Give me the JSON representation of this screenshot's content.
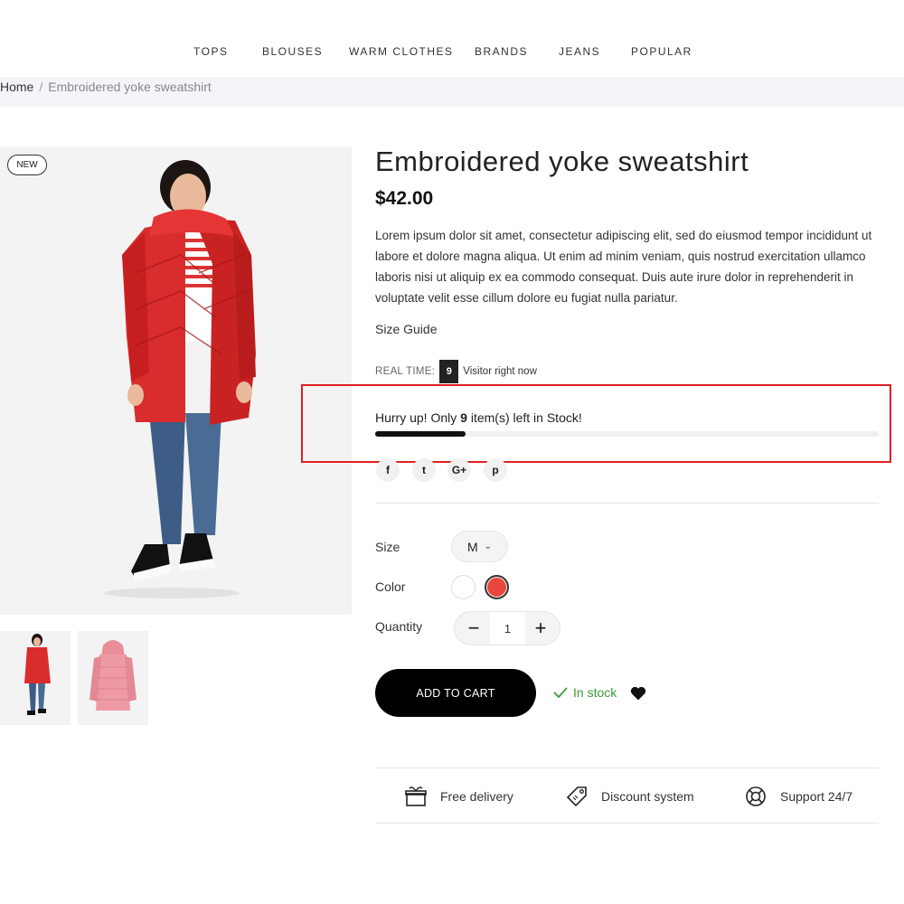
{
  "nav": {
    "items": [
      "TOPS",
      "BLOUSES",
      "WARM CLOTHES",
      "BRANDS",
      "JEANS",
      "POPULAR"
    ]
  },
  "breadcrumb": {
    "home": "Home",
    "separator": "/",
    "current": "Embroidered yoke sweatshirt"
  },
  "gallery": {
    "badge": "NEW",
    "thumbnails": [
      "red-coat-model",
      "pink-coat"
    ]
  },
  "product": {
    "title": "Embroidered yoke sweatshirt",
    "price": "$42.00",
    "description": "Lorem ipsum dolor sit amet, consectetur adipiscing elit, sed do eiusmod tempor incididunt ut labore et dolore magna aliqua. Ut enim ad minim veniam, quis nostrud exercitation ullamco laboris nisi ut aliquip ex ea commodo consequat. Duis aute irure dolor in reprehenderit in voluptate velit esse cillum dolore eu fugiat nulla pariatur.",
    "size_guide": "Size Guide"
  },
  "realtime": {
    "label": "REAL TIME:",
    "count": "9",
    "suffix": "Visitor right now"
  },
  "stock": {
    "prefix": "Hurry up! Only",
    "count": "9",
    "suffix": "item(s) left in Stock!",
    "progress_fraction": 0.18
  },
  "social": {
    "icons": [
      "facebook-icon",
      "twitter-icon",
      "google-plus-icon",
      "pinterest-icon"
    ],
    "glyphs": [
      "f",
      "t",
      "G+",
      "p"
    ]
  },
  "options": {
    "size_label": "Size",
    "size_value": "M",
    "color_label": "Color",
    "colors": [
      "#ffffff",
      "#e8473b"
    ],
    "quantity_label": "Quantity",
    "quantity_value": "1",
    "minus": "−",
    "plus": "+"
  },
  "actions": {
    "add_to_cart": "ADD TO CART",
    "in_stock": "In stock"
  },
  "features": {
    "delivery": "Free delivery",
    "discount": "Discount system",
    "support": "Support 24/7"
  },
  "colors": {
    "accent": "#000000",
    "highlight_border": "#e02020",
    "in_stock": "#3a9b3a",
    "coat_red": "#d92c2c"
  }
}
